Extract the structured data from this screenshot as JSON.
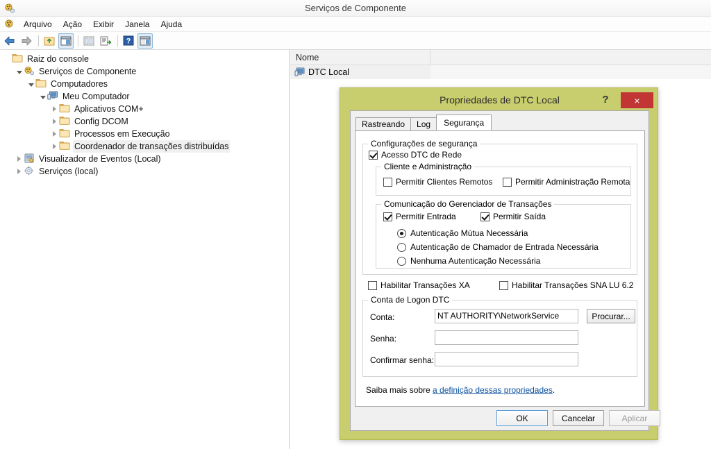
{
  "window": {
    "title": "Serviços de Componente",
    "icon": "component-services-icon"
  },
  "menubar": {
    "icon": "console-icon",
    "items": [
      {
        "label": "Arquivo"
      },
      {
        "label": "Ação"
      },
      {
        "label": "Exibir"
      },
      {
        "label": "Janela"
      },
      {
        "label": "Ajuda"
      }
    ]
  },
  "toolbar": {
    "buttons": [
      {
        "name": "back-icon",
        "glyph": "←",
        "selected": false
      },
      {
        "name": "forward-icon",
        "glyph": "→",
        "selected": false
      },
      {
        "name": "up-one-level-icon",
        "glyph": "⬆",
        "selected": false
      },
      {
        "name": "show-hide-tree-icon",
        "glyph": "▤",
        "selected": true
      },
      {
        "name": "properties-icon",
        "glyph": "▧",
        "selected": false
      },
      {
        "name": "export-list-icon",
        "glyph": "≡",
        "selected": false
      },
      {
        "name": "help-icon",
        "glyph": "?",
        "selected": false
      },
      {
        "name": "show-console-tree-icon",
        "glyph": "▤",
        "selected": true
      }
    ]
  },
  "tree": {
    "nodes": [
      {
        "label": "Raiz do console",
        "indent": 0,
        "twist": "none",
        "icon": "folder-icon",
        "selected": false
      },
      {
        "label": "Serviços de Componente",
        "indent": 1,
        "twist": "open",
        "icon": "component-services-icon",
        "selected": false
      },
      {
        "label": "Computadores",
        "indent": 2,
        "twist": "open",
        "icon": "folder-icon",
        "selected": false
      },
      {
        "label": "Meu Computador",
        "indent": 3,
        "twist": "open",
        "icon": "computer-icon",
        "selected": false
      },
      {
        "label": "Aplicativos COM+",
        "indent": 4,
        "twist": "closed",
        "icon": "folder-icon",
        "selected": false
      },
      {
        "label": "Config DCOM",
        "indent": 4,
        "twist": "closed",
        "icon": "folder-icon",
        "selected": false
      },
      {
        "label": "Processos em Execução",
        "indent": 4,
        "twist": "closed",
        "icon": "folder-icon",
        "selected": false
      },
      {
        "label": "Coordenador de transações distribuídas",
        "indent": 4,
        "twist": "closed",
        "icon": "folder-icon",
        "selected": true
      },
      {
        "label": "Visualizador de Eventos (Local)",
        "indent": 1,
        "twist": "closed",
        "icon": "event-viewer-icon",
        "selected": false
      },
      {
        "label": "Serviços (local)",
        "indent": 1,
        "twist": "closed",
        "icon": "services-icon",
        "selected": false
      }
    ]
  },
  "listview": {
    "columns": [
      "Nome",
      ""
    ],
    "rows": [
      {
        "name": "DTC Local",
        "icon": "computer-icon"
      }
    ]
  },
  "dialog": {
    "title": "Propriedades de DTC Local",
    "help_glyph": "?",
    "close_glyph": "×",
    "tabs": [
      {
        "label": "Rastreando",
        "active": false
      },
      {
        "label": "Log",
        "active": false
      },
      {
        "label": "Segurança",
        "active": true
      }
    ],
    "security_group": {
      "legend": "Configurações de segurança",
      "network_dtc_access": {
        "label": "Acesso DTC de Rede",
        "checked": true
      },
      "client_admin_group": {
        "legend": "Cliente e Administração",
        "allow_remote_clients": {
          "label": "Permitir Clientes Remotos",
          "checked": false
        },
        "allow_remote_admin": {
          "label": "Permitir Administração Remota",
          "checked": false
        }
      },
      "tm_comm_group": {
        "legend": "Comunicação do Gerenciador de Transações",
        "allow_inbound": {
          "label": "Permitir Entrada",
          "checked": true
        },
        "allow_outbound": {
          "label": "Permitir Saída",
          "checked": true
        },
        "auth_options": [
          {
            "label": "Autenticação Mútua Necessária",
            "selected": true
          },
          {
            "label": "Autenticação de Chamador de Entrada Necessária",
            "selected": false
          },
          {
            "label": "Nenhuma Autenticação Necessária",
            "selected": false
          }
        ]
      },
      "enable_xa": {
        "label": "Habilitar Transações XA",
        "checked": false
      },
      "enable_sna": {
        "label": "Habilitar Transações SNA LU 6.2",
        "checked": false
      }
    },
    "logon_group": {
      "legend": "Conta de Logon DTC",
      "account_label": "Conta:",
      "account_value": "NT AUTHORITY\\NetworkService",
      "browse_button": "Procurar...",
      "password_label": "Senha:",
      "password_value": "",
      "confirm_label": "Confirmar senha:",
      "confirm_value": ""
    },
    "help_prefix": "Saiba mais sobre ",
    "help_link": "a definição dessas propriedades",
    "help_suffix": ".",
    "buttons": {
      "ok": "OK",
      "cancel": "Cancelar",
      "apply": "Aplicar"
    }
  },
  "colors": {
    "dialog_border": "#c8cd6e",
    "close_button": "#c13535",
    "link": "#0b4f9e",
    "selection": "#f0f0f0"
  }
}
